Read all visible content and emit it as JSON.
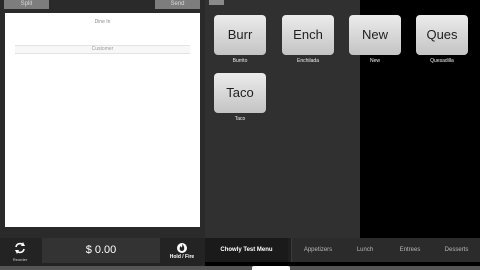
{
  "ticket": {
    "split_label": "Split",
    "send_label": "Send",
    "dine_in_label": "Dine In",
    "customer_label": "Customer"
  },
  "footer": {
    "reorder_label": "Reorder",
    "total": "$ 0.00",
    "hold_fire_label": "Hold / Fire",
    "reorder_icon": "reorder-icon",
    "hold_fire_icon": "fire-icon"
  },
  "menu": {
    "items": [
      {
        "tile": "Burr",
        "label": "Burrito"
      },
      {
        "tile": "Ench",
        "label": "Enchilada"
      },
      {
        "tile": "New",
        "label": "New"
      },
      {
        "tile": "Ques",
        "label": "Quesadilla"
      },
      {
        "tile": "Taco",
        "label": "Taco"
      }
    ]
  },
  "tabs": {
    "active": "Chowly Test Menu",
    "items": [
      "Appetizers",
      "Lunch",
      "Entrees",
      "Desserts"
    ]
  },
  "colors": {
    "panel_background": "#303030",
    "tile_background": "#dcdcdc",
    "ticket_background": "#ffffff"
  }
}
